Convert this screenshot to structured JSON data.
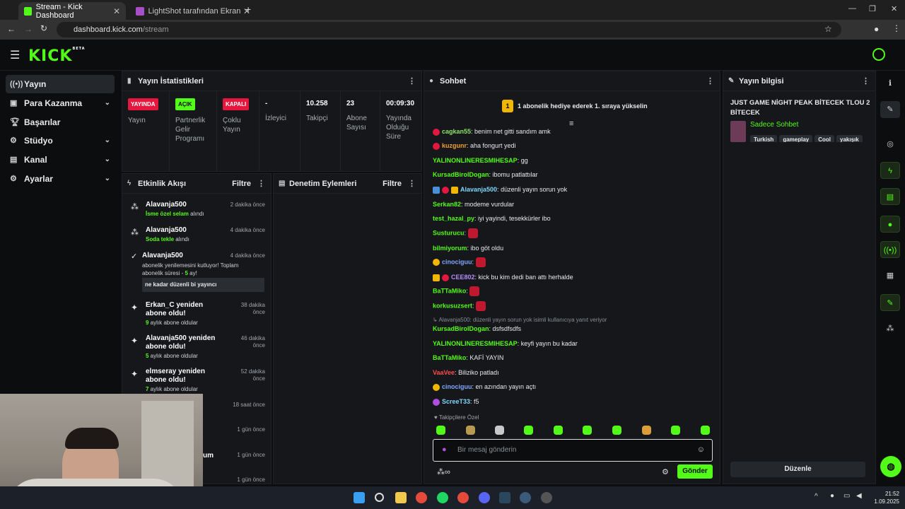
{
  "browser": {
    "tabs": [
      {
        "label": "Stream - Kick Dashboard",
        "active": true
      },
      {
        "label": "LightShot tarafından Ekran Gör...",
        "active": false
      }
    ],
    "url_host": "dashboard.kick.com",
    "url_path": "/stream"
  },
  "brand": {
    "logo": "KICK",
    "beta": "BETA",
    "accent": "#53fc18"
  },
  "sidebar": {
    "items": [
      {
        "label": "Yayın",
        "icon": "broadcast-icon",
        "active": true
      },
      {
        "label": "Para Kazanma",
        "icon": "money-icon"
      },
      {
        "label": "Başarılar",
        "icon": "trophy-icon"
      },
      {
        "label": "Stüdyo",
        "icon": "gear-icon"
      },
      {
        "label": "Kanal",
        "icon": "channel-icon"
      },
      {
        "label": "Ayarlar",
        "icon": "settings-icon"
      }
    ]
  },
  "stats": {
    "title": "Yayın İstatistikleri",
    "items": [
      {
        "badge": "YAYINDA",
        "label": "Yayın"
      },
      {
        "badge": "AÇIK",
        "label": "Partnerlik Gelir Programı"
      },
      {
        "badge": "KAPALI",
        "label": "Çoklu Yayın"
      },
      {
        "value": "-",
        "label": "İzleyici"
      },
      {
        "value": "10.258",
        "label": "Takipçi"
      },
      {
        "value": "23",
        "label": "Abone Sayısı"
      },
      {
        "value": "00:09:30",
        "label": "Yayında Olduğu Süre"
      }
    ]
  },
  "activity": {
    "title": "Etkinlik Akışı",
    "filter": "Filtre",
    "events": [
      {
        "name": "Alavanja500",
        "sub_hl": "İsme özel selam",
        "sub": " alındı",
        "time": "2 dakika önce"
      },
      {
        "name": "Alavanja500",
        "sub_hl": "Soda tekle",
        "sub": " alındı",
        "time": "4 dakika önce"
      },
      {
        "name": "Alavanja500",
        "sub": "abonelik yenilemesini kutluyor! Toplam abonelik süresi - ",
        "sub_hl": "5",
        "sub2": " ay!",
        "msg": "ne kadar düzenli bi yayıncı",
        "time": "4 dakika önce"
      },
      {
        "name": "Erkan_C yeniden abone oldu!",
        "sub_hl": "9",
        "sub": " aylık abone oldular",
        "time": "38 dakika önce"
      },
      {
        "name": "Alavanja500 yeniden abone oldu!",
        "sub_hl": "5",
        "sub": " aylık abone oldular",
        "time": "46 dakika önce"
      },
      {
        "name": "elmseray yeniden abone oldu!",
        "sub_hl": "7",
        "sub": " aylık abone oldular",
        "time": "52 dakika önce"
      },
      {
        "time": "18 saat önce"
      },
      {
        "time": "1 gün önce"
      },
      {
        "name": "um",
        "time": "1 gün önce"
      },
      {
        "time": "1 gün önce"
      }
    ]
  },
  "moderation": {
    "title": "Denetim Eylemleri",
    "filter": "Filtre"
  },
  "chat": {
    "title": "Sohbet",
    "pinned": "1 abonelik hediye ederek 1. sıraya yükselin",
    "messages": [
      {
        "user": "cagkan55",
        "color": "#8ee36b",
        "text": "benim net gitti sandım amk"
      },
      {
        "user": "kuzgunr",
        "color": "#f0a030",
        "text": "aha fongurt yedi"
      },
      {
        "user": "YALINONLINERESMIHESAP",
        "color": "#53fc18",
        "text": "gg"
      },
      {
        "user": "KursadBirolDogan",
        "color": "#53fc18",
        "text": "ibomu patlattılar"
      },
      {
        "user": "Alavanja500",
        "color": "#7fd7ff",
        "text": "düzenli yayın sorun yok"
      },
      {
        "user": "Serkan82",
        "color": "#53fc18",
        "text": "modeme vurdular"
      },
      {
        "user": "test_hazal_py",
        "color": "#53fc18",
        "text": "iyi yayindi, tesekkürler ibo"
      },
      {
        "user": "Susturucu",
        "color": "#53fc18",
        "text": ""
      },
      {
        "user": "bilmiyorum",
        "color": "#53fc18",
        "text": "ibo göt oldu"
      },
      {
        "user": "cinociguu",
        "color": "#7fa7ff",
        "text": ""
      },
      {
        "user": "CEE802",
        "color": "#b48cff",
        "text": "kick bu kim dedi ban attı herhalde"
      },
      {
        "user": "BaTTaMiko",
        "color": "#53fc18",
        "text": ""
      },
      {
        "user": "korkusuzsert",
        "color": "#53fc18",
        "text": ""
      },
      {
        "reply": "Alavanja500: düzenli yayın sorun yok isimli kullanıcıya yanıt veriyor"
      },
      {
        "user": "KursadBirolDogan",
        "color": "#53fc18",
        "text": "dsfsdfsdfs"
      },
      {
        "user": "YALINONLINERESMIHESAP",
        "color": "#53fc18",
        "text": "keyfi yayın bu kadar"
      },
      {
        "user": "BaTTaMiko",
        "color": "#53fc18",
        "text": "KAFİ YAYIN"
      },
      {
        "user": "VaaVee",
        "color": "#ff4d4d",
        "text": "Biliziko patladı"
      },
      {
        "user": "cinociguu",
        "color": "#7fa7ff",
        "text": "en azından yayın açtı"
      },
      {
        "user": "ScreeT33",
        "color": "#7fd7ff",
        "text": "f5"
      }
    ],
    "followers_only": "Takipçilere Özel",
    "input_placeholder": "Bir mesaj gönderin",
    "send": "Gönder"
  },
  "stream_info": {
    "title": "Yayın bilgisi",
    "stream_title": "JUST GAME NİGHT PEAK BİTECEK TLOU 2 BİTECEK",
    "category": "Sadece Sohbet",
    "tags": [
      "Turkish",
      "gameplay",
      "Cool",
      "yakışık"
    ],
    "edit": "Düzenle"
  },
  "taskbar": {
    "time": "21:52",
    "date": "1.09.2025"
  }
}
